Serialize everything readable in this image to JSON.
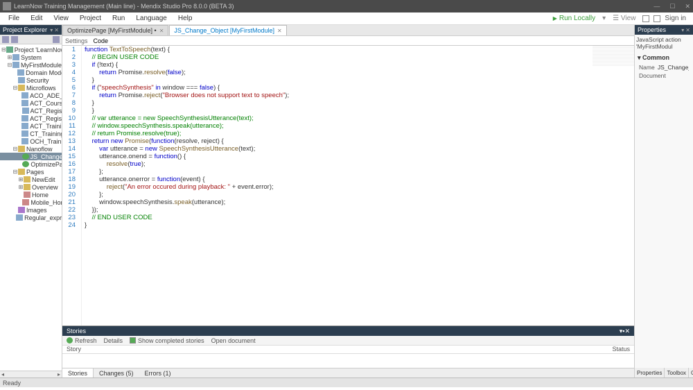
{
  "window": {
    "title": "LearnNow Training Management (Main line) - Mendix Studio Pro 8.0.0 (BETA 3)"
  },
  "menubar": {
    "items": [
      "File",
      "Edit",
      "View",
      "Project",
      "Run",
      "Language",
      "Help"
    ],
    "run": "Run Locally",
    "view": "View",
    "signin": "Sign in"
  },
  "explorer": {
    "title": "Project Explorer",
    "nodes": [
      {
        "depth": 0,
        "exp": "⊟",
        "icon": "ti-proj",
        "label": "Project 'LearnNow Trainin"
      },
      {
        "depth": 1,
        "exp": "⊞",
        "icon": "ti-doc",
        "label": "System"
      },
      {
        "depth": 1,
        "exp": "⊟",
        "icon": "ti-doc",
        "label": "MyFirstModule"
      },
      {
        "depth": 2,
        "exp": "",
        "icon": "ti-doc",
        "label": "Domain Model"
      },
      {
        "depth": 2,
        "exp": "",
        "icon": "ti-doc",
        "label": "Security"
      },
      {
        "depth": 2,
        "exp": "⊟",
        "icon": "ti-folder",
        "label": "Microflows"
      },
      {
        "depth": 3,
        "exp": "",
        "icon": "ti-doc",
        "label": "ACO_ADE_Regis"
      },
      {
        "depth": 3,
        "exp": "",
        "icon": "ti-doc",
        "label": "ACT_Course_Sch"
      },
      {
        "depth": 3,
        "exp": "",
        "icon": "ti-doc",
        "label": "ACT_Registratio"
      },
      {
        "depth": 3,
        "exp": "",
        "icon": "ti-doc",
        "label": "ACT_Registration"
      },
      {
        "depth": 3,
        "exp": "",
        "icon": "ti-doc",
        "label": "ACT_TrainingEve"
      },
      {
        "depth": 3,
        "exp": "",
        "icon": "ti-doc",
        "label": "CT_TrainingEven"
      },
      {
        "depth": 3,
        "exp": "",
        "icon": "ti-doc",
        "label": "OCH_TrainingEv"
      },
      {
        "depth": 2,
        "exp": "⊟",
        "icon": "ti-folder",
        "label": "Nanoflow"
      },
      {
        "depth": 3,
        "exp": "",
        "icon": "ti-green",
        "label": "JS_Change_Obj",
        "selected": true
      },
      {
        "depth": 3,
        "exp": "",
        "icon": "ti-green",
        "label": "OptimizePage"
      },
      {
        "depth": 2,
        "exp": "⊟",
        "icon": "ti-folder",
        "label": "Pages"
      },
      {
        "depth": 3,
        "exp": "⊞",
        "icon": "ti-folder",
        "label": "NewEdit"
      },
      {
        "depth": 3,
        "exp": "⊞",
        "icon": "ti-folder",
        "label": "Overview"
      },
      {
        "depth": 3,
        "exp": "",
        "icon": "ti-page",
        "label": "Home"
      },
      {
        "depth": 3,
        "exp": "",
        "icon": "ti-page",
        "label": "Mobile_Home"
      },
      {
        "depth": 2,
        "exp": "",
        "icon": "ti-img",
        "label": "Images"
      },
      {
        "depth": 2,
        "exp": "",
        "icon": "ti-doc",
        "label": "Regular_expression_"
      }
    ]
  },
  "tabs": [
    {
      "label": "OptimizePage [MyFirstModule] •",
      "active": false
    },
    {
      "label": "JS_Change_Object [MyFirstModule]",
      "active": true
    }
  ],
  "subtabs": {
    "items": [
      "Settings",
      "Code"
    ],
    "active": 1
  },
  "code": {
    "lines": [
      {
        "n": 1,
        "tokens": [
          [
            "kw",
            "function"
          ],
          [
            "",
            " "
          ],
          [
            "fn",
            "TextToSpeech"
          ],
          [
            "",
            "(text) "
          ],
          [
            "",
            "{"
          ]
        ]
      },
      {
        "n": 2,
        "indent": 1,
        "tokens": [
          [
            "com",
            "// BEGIN USER CODE"
          ]
        ]
      },
      {
        "n": 3,
        "indent": 1,
        "tokens": [
          [
            "kw",
            "if"
          ],
          [
            "",
            " (!text) {"
          ]
        ]
      },
      {
        "n": 4,
        "indent": 2,
        "tokens": [
          [
            "kw",
            "return"
          ],
          [
            "",
            " Promise."
          ],
          [
            "fn",
            "resolve"
          ],
          [
            "",
            "("
          ],
          [
            "bool",
            "false"
          ],
          [
            "",
            ");"
          ]
        ]
      },
      {
        "n": 5,
        "indent": 1,
        "tokens": [
          [
            "",
            "}"
          ]
        ]
      },
      {
        "n": 6,
        "indent": 1,
        "tokens": [
          [
            "kw",
            "if"
          ],
          [
            "",
            " ("
          ],
          [
            "str",
            "\"speechSynthesis\""
          ],
          [
            "",
            " "
          ],
          [
            "kw",
            "in"
          ],
          [
            "",
            " window === "
          ],
          [
            "bool",
            "false"
          ],
          [
            "",
            ") {"
          ]
        ]
      },
      {
        "n": 7,
        "indent": 2,
        "tokens": [
          [
            "kw",
            "return"
          ],
          [
            "",
            " Promise."
          ],
          [
            "fn",
            "reject"
          ],
          [
            "",
            "("
          ],
          [
            "str",
            "\"Browser does not support text to speech\""
          ],
          [
            "",
            ");"
          ]
        ]
      },
      {
        "n": 8,
        "indent": 1,
        "tokens": [
          [
            "",
            "}"
          ]
        ]
      },
      {
        "n": 9,
        "indent": 1,
        "tokens": [
          [
            "",
            "}"
          ]
        ]
      },
      {
        "n": 10,
        "indent": 1,
        "tokens": [
          [
            "com",
            "// var utterance = new SpeechSynthesisUtterance(text);"
          ]
        ]
      },
      {
        "n": 11,
        "indent": 1,
        "tokens": [
          [
            "com",
            "// window.speechSynthesis.speak(utterance);"
          ]
        ]
      },
      {
        "n": 12,
        "indent": 1,
        "tokens": [
          [
            "com",
            "// return Promise.resolve(true);"
          ]
        ]
      },
      {
        "n": 13,
        "indent": 1,
        "tokens": [
          [
            "kw",
            "return new"
          ],
          [
            "",
            " "
          ],
          [
            "fn",
            "Promise"
          ],
          [
            "",
            "("
          ],
          [
            "kw",
            "function"
          ],
          [
            "",
            "(resolve, reject) {"
          ]
        ]
      },
      {
        "n": 14,
        "indent": 2,
        "tokens": [
          [
            "kw",
            "var"
          ],
          [
            "",
            " utterance = "
          ],
          [
            "kw",
            "new"
          ],
          [
            "",
            " "
          ],
          [
            "fn",
            "SpeechSynthesisUtterance"
          ],
          [
            "",
            "(text);"
          ]
        ]
      },
      {
        "n": 15,
        "indent": 2,
        "tokens": [
          [
            "",
            "utterance.onend = "
          ],
          [
            "kw",
            "function"
          ],
          [
            "",
            "() {"
          ]
        ]
      },
      {
        "n": 16,
        "indent": 3,
        "tokens": [
          [
            "fn",
            "resolve"
          ],
          [
            "",
            "("
          ],
          [
            "bool",
            "true"
          ],
          [
            "",
            ");"
          ]
        ]
      },
      {
        "n": 17,
        "indent": 2,
        "tokens": [
          [
            "",
            "};"
          ]
        ]
      },
      {
        "n": 18,
        "indent": 2,
        "tokens": [
          [
            "",
            "utterance.onerror = "
          ],
          [
            "kw",
            "function"
          ],
          [
            "",
            "(event) {"
          ]
        ]
      },
      {
        "n": 19,
        "indent": 3,
        "tokens": [
          [
            "fn",
            "reject"
          ],
          [
            "",
            "("
          ],
          [
            "str",
            "\"An error occured during playback: \""
          ],
          [
            "",
            " + event.error);"
          ]
        ]
      },
      {
        "n": 20,
        "indent": 2,
        "tokens": [
          [
            "",
            "};"
          ]
        ]
      },
      {
        "n": 21,
        "indent": 2,
        "tokens": [
          [
            "",
            "window.speechSynthesis."
          ],
          [
            "fn",
            "speak"
          ],
          [
            "",
            "(utterance);"
          ]
        ]
      },
      {
        "n": 22,
        "indent": 1,
        "tokens": [
          [
            "",
            "});"
          ]
        ]
      },
      {
        "n": 23,
        "indent": 1,
        "tokens": [
          [
            "com",
            "// END USER CODE"
          ]
        ]
      },
      {
        "n": 24,
        "indent": 0,
        "tokens": [
          [
            "",
            "}"
          ]
        ]
      }
    ]
  },
  "stories": {
    "title": "Stories",
    "toolbar": {
      "refresh": "Refresh",
      "details": "Details",
      "showCompleted": "Show completed stories",
      "openDoc": "Open document"
    },
    "cols": {
      "story": "Story",
      "status": "Status"
    }
  },
  "bottomTabs": [
    "Stories",
    "Changes (5)",
    "Errors (1)"
  ],
  "properties": {
    "title": "Properties",
    "desc": "JavaScript action 'MyFirstModul",
    "section": "Common",
    "rows": [
      {
        "k": "Name",
        "v": "JS_Change_Obje"
      },
      {
        "k": "Document",
        "v": ""
      }
    ],
    "tabs": [
      "Properties",
      "Toolbox",
      "Connector"
    ]
  },
  "statusbar": {
    "text": "Ready"
  }
}
